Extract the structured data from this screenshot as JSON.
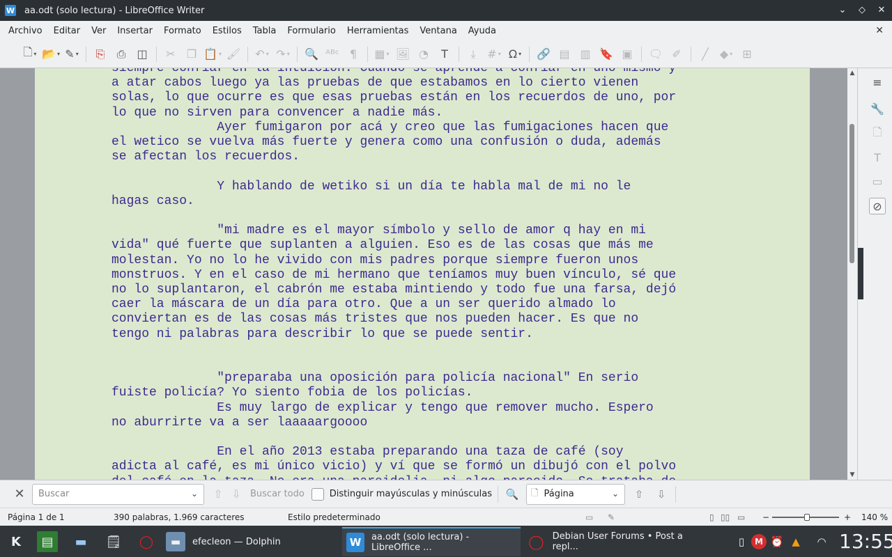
{
  "window": {
    "title": "aa.odt (solo lectura) - LibreOffice Writer",
    "app_icon_letter": "W"
  },
  "menu": {
    "items": [
      "Archivo",
      "Editar",
      "Ver",
      "Insertar",
      "Formato",
      "Estilos",
      "Tabla",
      "Formulario",
      "Herramientas",
      "Ventana",
      "Ayuda"
    ]
  },
  "document": {
    "paragraphs": [
      "siempre confiar en la intuición. Cuando se aprende a confiar en uno mismo y",
      "a atar cabos luego ya las pruebas de que estabamos en lo cierto vienen",
      "solas, lo que ocurre es que esas pruebas están en los recuerdos de uno, por",
      "lo que no sirven para convencer a nadie más.",
      "              Ayer fumigaron por acá y creo que las fumigaciones hacen que",
      "el wetico se vuelva más fuerte y genera como una confusión o duda, además",
      "se afectan los recuerdos.",
      "",
      "              Y hablando de wetiko si un día te habla mal de mi no le",
      "hagas caso.",
      "",
      "              \"mi madre es el mayor símbolo y sello de amor q hay en mi",
      "vida\" qué fuerte que suplanten a alguien. Eso es de las cosas que más me",
      "molestan. Yo no lo he vivido con mis padres porque siempre fueron unos",
      "monstruos. Y en el caso de mi hermano que teníamos muy buen vínculo, sé que",
      "no lo suplantaron, el cabrón me estaba mintiendo y todo fue una farsa, dejó",
      "caer la máscara de un día para otro. Que a un ser querido almado lo",
      "conviertan es de las cosas más tristes que nos pueden hacer. Es que no",
      "tengo ni palabras para describir lo que se puede sentir.",
      "",
      "",
      "              \"preparaba una oposición para policía nacional\" En serio",
      "fuiste policía? Yo siento fobia de los policías.",
      "              Es muy largo de explicar y tengo que remover mucho. Espero",
      "no aburrirte va a ser laaaaargoooo",
      "",
      "              En el año 2013 estaba preparando una taza de café (soy",
      "adicta al café, es mi único vicio) y ví que se formó un dibujó con el polvo",
      "del café en la taza. No era una pareidolia, ni algo parecido. Se trataba de"
    ]
  },
  "findbar": {
    "search_placeholder": "Buscar",
    "find_all": "Buscar todo",
    "match_case": "Distinguir mayúsculas y minúsculas",
    "match_case_checked": false,
    "search_scope": "Página"
  },
  "statusbar": {
    "page": "Página 1 de 1",
    "word_count": "390 palabras, 1.969 caracteres",
    "page_style": "Estilo predeterminado",
    "zoom": "140 %",
    "zoom_minus": "−",
    "zoom_plus": "+"
  },
  "taskbar": {
    "tasks": [
      {
        "label": "efecleon — Dolphin"
      },
      {
        "label": "aa.odt (solo lectura) - LibreOffice ..."
      },
      {
        "label": "Debian User Forums • Post a repl..."
      }
    ],
    "clock": "13:55"
  },
  "colors": {
    "document_text": "#3b2a8f",
    "page_background": "#dde9cf",
    "taskbar": "#31363b",
    "titlebar": "#2b3035",
    "active_task_accent": "#3daee9"
  }
}
